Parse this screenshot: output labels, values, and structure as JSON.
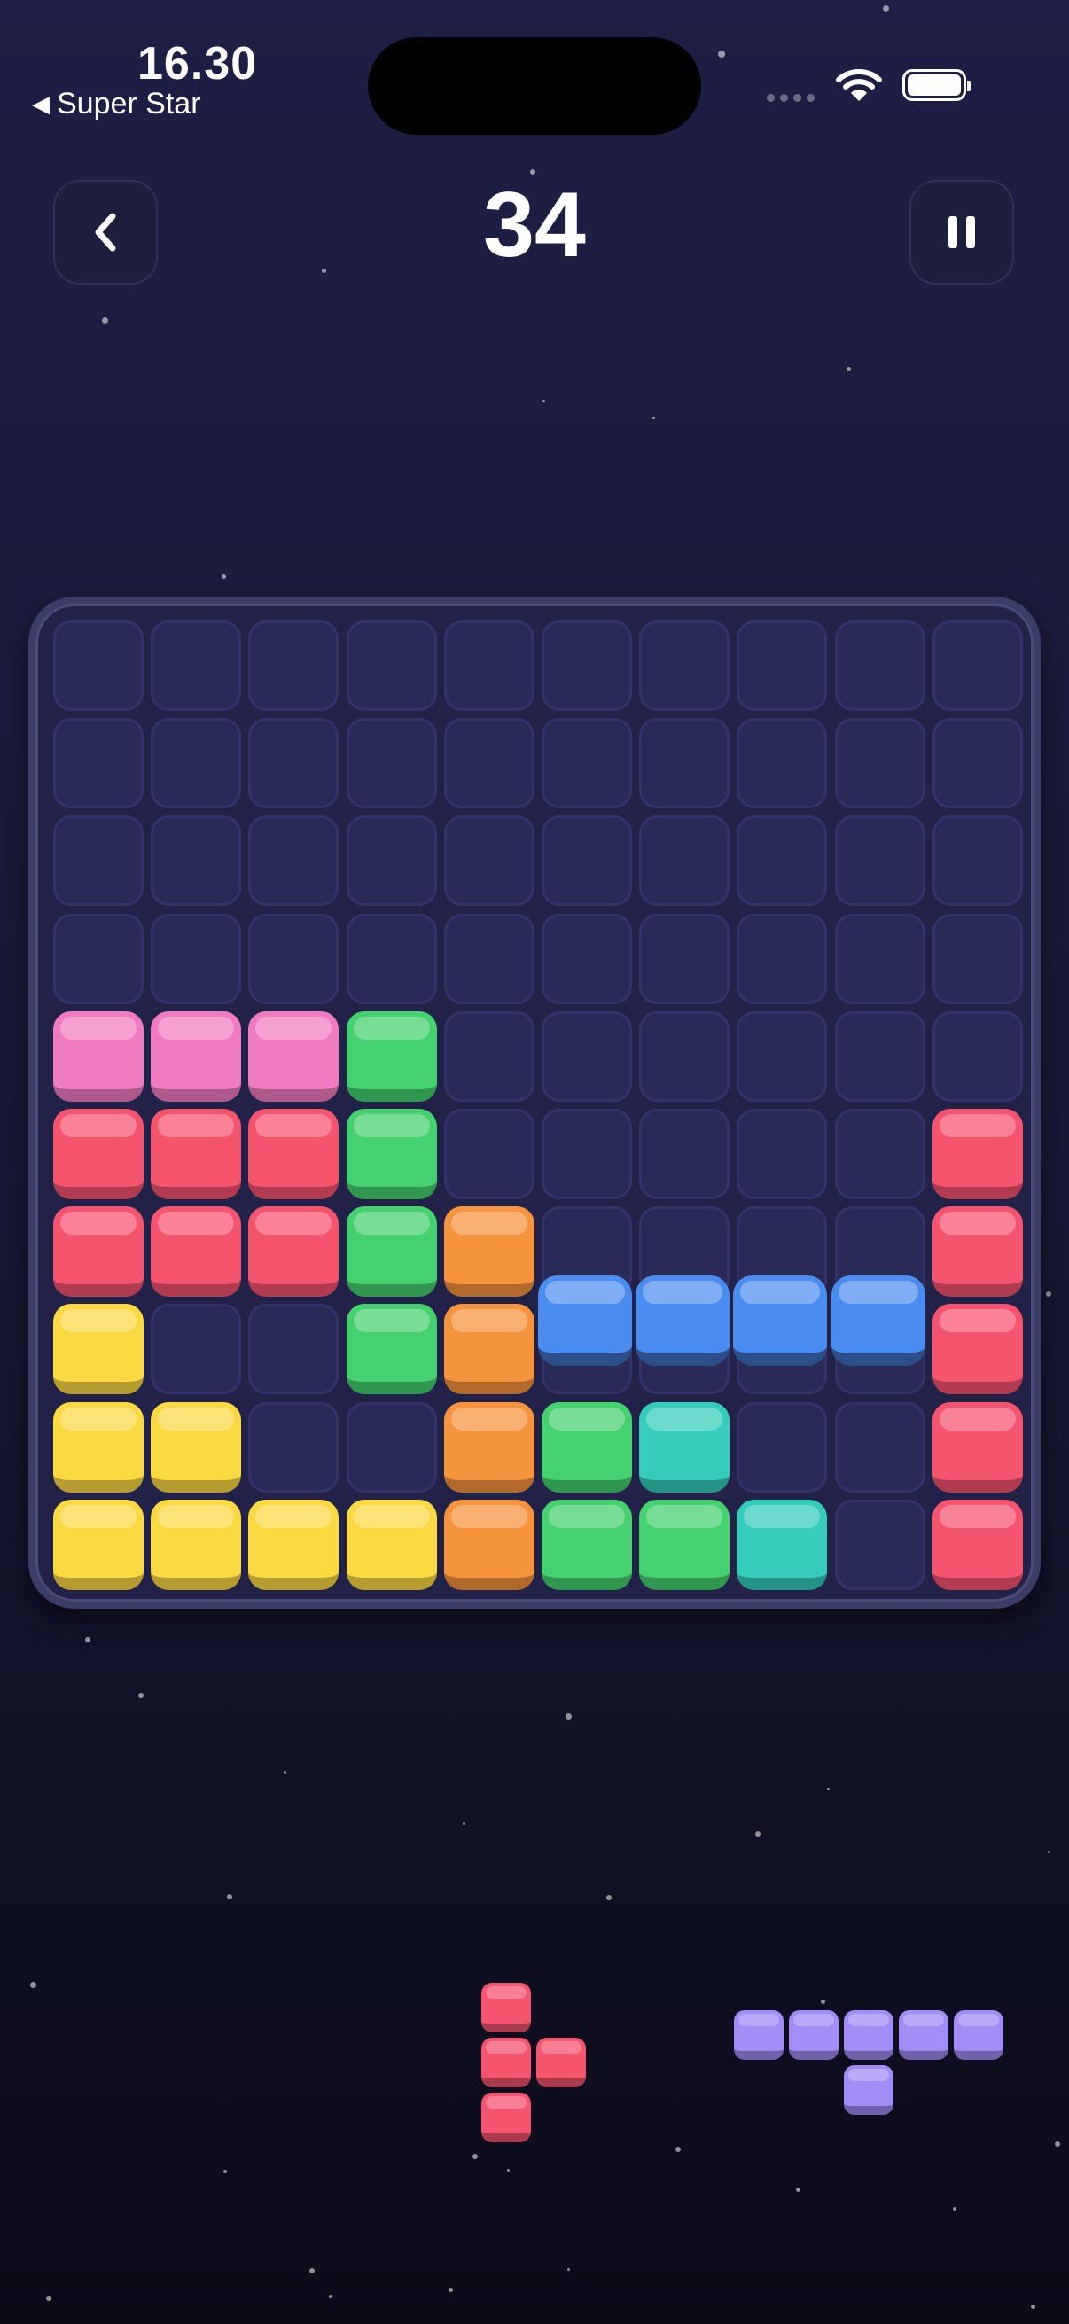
{
  "status_bar": {
    "time": "16.30",
    "back_label": "Super Star"
  },
  "header": {
    "score": "34"
  },
  "colors": {
    "pink": "#f07cc0",
    "red": "#f5546f",
    "green": "#45d170",
    "orange": "#f6933d",
    "yellow": "#fbd943",
    "blue": "#4a8cf0",
    "teal": "#35cdb9",
    "purple": "#a28cf5"
  },
  "board": {
    "cols": 10,
    "rows": 10,
    "cells": [
      [
        "",
        "",
        "",
        "",
        "",
        "",
        "",
        "",
        "",
        ""
      ],
      [
        "",
        "",
        "",
        "",
        "",
        "",
        "",
        "",
        "",
        ""
      ],
      [
        "",
        "",
        "",
        "",
        "",
        "",
        "",
        "",
        "",
        ""
      ],
      [
        "",
        "",
        "",
        "",
        "",
        "",
        "",
        "",
        "",
        ""
      ],
      [
        "pink",
        "pink",
        "pink",
        "green",
        "",
        "",
        "",
        "",
        "",
        ""
      ],
      [
        "red",
        "red",
        "red",
        "green",
        "",
        "",
        "",
        "",
        "",
        "red"
      ],
      [
        "red",
        "red",
        "red",
        "green",
        "orange",
        "",
        "",
        "",
        "",
        "red"
      ],
      [
        "yellow",
        "",
        "",
        "green",
        "orange",
        "",
        "",
        "",
        "",
        "red"
      ],
      [
        "yellow",
        "yellow",
        "",
        "",
        "orange",
        "green",
        "teal",
        "",
        "",
        "red"
      ],
      [
        "yellow",
        "yellow",
        "yellow",
        "yellow",
        "orange",
        "green",
        "green",
        "teal",
        "",
        "red"
      ]
    ],
    "drag_preview": {
      "color": "blue",
      "row": 7,
      "cols": [
        5,
        6,
        7,
        8
      ]
    }
  },
  "tray": {
    "pieces": [
      {
        "name": "red-plus-piece",
        "color": "red",
        "blocks": [
          [
            0,
            0
          ],
          [
            1,
            0
          ],
          [
            1,
            1
          ],
          [
            2,
            0
          ]
        ]
      },
      {
        "name": "purple-t-piece",
        "color": "purple",
        "blocks": [
          [
            0,
            0
          ],
          [
            0,
            1
          ],
          [
            0,
            2
          ],
          [
            0,
            3
          ],
          [
            0,
            4
          ],
          [
            1,
            2
          ]
        ]
      }
    ]
  }
}
